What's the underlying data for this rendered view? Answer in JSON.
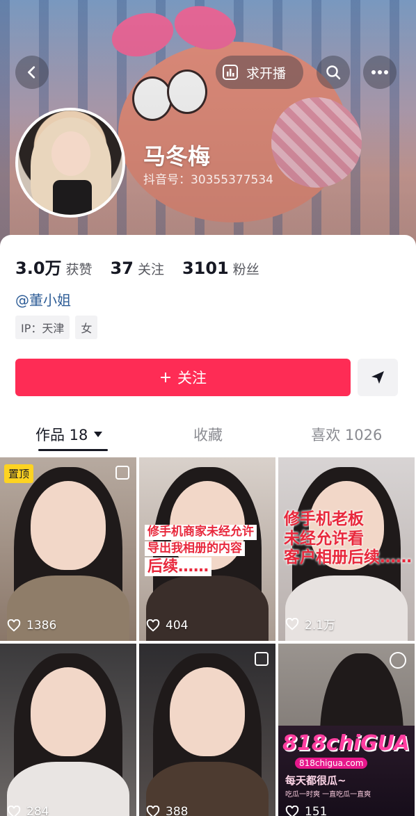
{
  "header": {
    "live_label": "求开播",
    "nickname": "马冬梅",
    "douyin_id": "抖音号：30355377534"
  },
  "stats": [
    {
      "num": "3.0万",
      "label": "获赞"
    },
    {
      "num": "37",
      "label": "关注"
    },
    {
      "num": "3101",
      "label": "粉丝"
    }
  ],
  "mention": "@董小姐",
  "tags": [
    "IP：天津",
    "女"
  ],
  "follow_label": "关注",
  "tabs": [
    {
      "label": "作品 18"
    },
    {
      "label": "收藏"
    },
    {
      "label": "喜欢 1026"
    }
  ],
  "posts": [
    {
      "likes": "1386",
      "badge": "置顶"
    },
    {
      "likes": "404",
      "caption_lines": [
        "修手机商家未经允许",
        "导出我相册的内容",
        "后续……"
      ]
    },
    {
      "likes": "2.1万",
      "caption_lines": [
        "修手机老板",
        "未经允许看",
        "客户相册后续……"
      ]
    },
    {
      "likes": "284"
    },
    {
      "likes": "388"
    },
    {
      "likes": "151",
      "ad_logo": "818chiGUA",
      "ad_site": "818chigua.com",
      "ad_text": "每天都很瓜~",
      "ad_small": "吃瓜一时爽 一直吃瓜一直爽"
    }
  ],
  "colors": {
    "accent": "#fe2c55",
    "mention": "#2d5c96",
    "pin": "#fdd321"
  },
  "icons": {
    "back": "chevron-left-icon",
    "search": "search-icon",
    "more": "more-icon",
    "live": "chart-icon",
    "share": "send-icon",
    "like": "heart-icon"
  }
}
